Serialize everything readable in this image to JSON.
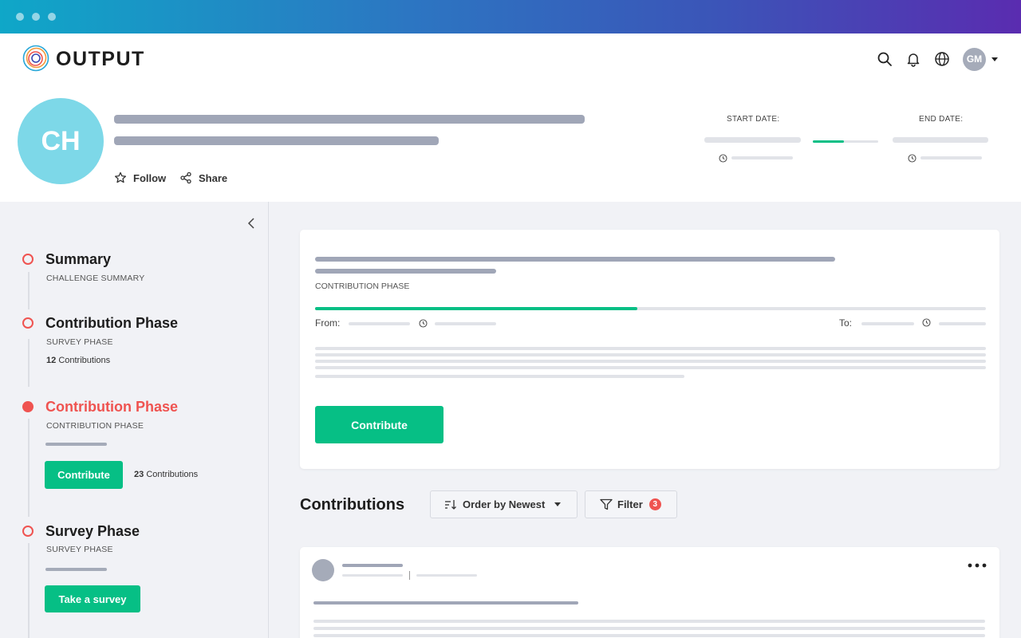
{
  "brand": {
    "name": "OUTPUT"
  },
  "user": {
    "initials": "GM"
  },
  "challenge": {
    "initials": "CH",
    "follow_label": "Follow",
    "share_label": "Share",
    "start_date_label": "START DATE:",
    "end_date_label": "END DATE:"
  },
  "sidebar": {
    "steps": [
      {
        "title": "Summary",
        "subtitle": "CHALLENGE SUMMARY"
      },
      {
        "title": "Contribution Phase",
        "subtitle": "SURVEY PHASE",
        "count": "12",
        "count_label": "Contributions"
      },
      {
        "title": "Contribution Phase",
        "subtitle": "CONTRIBUTION PHASE",
        "button": "Contribute",
        "count": "23",
        "count_label": "Contributions"
      },
      {
        "title": "Survey Phase",
        "subtitle": "SURVEY PHASE",
        "button": "Take a survey"
      }
    ]
  },
  "phase_card": {
    "subtitle": "CONTRIBUTION PHASE",
    "from_label": "From:",
    "to_label": "To:",
    "button": "Contribute",
    "progress": 0.48
  },
  "contributions": {
    "title": "Contributions",
    "order_label": "Order by Newest",
    "filter_label": "Filter",
    "filter_count": "3"
  },
  "colors": {
    "accent": "#06bf85",
    "active": "#ef5350",
    "skeleton": "#a0a6b7"
  }
}
